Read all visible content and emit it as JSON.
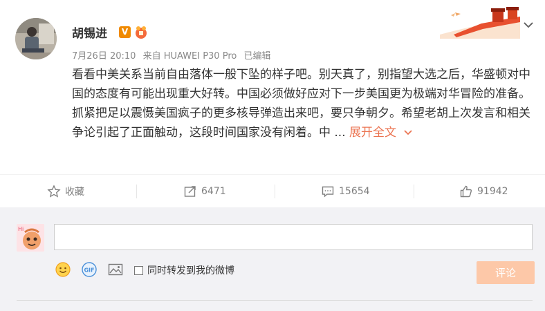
{
  "post": {
    "username": "胡锡进",
    "vip_badge": "V",
    "date": "7月26日 20:10",
    "source": "来自 HUAWEI P30 Pro",
    "edited": "已编辑",
    "paragraph1": "看看中美关系当前自由落体一般下坠的样子吧。别天真了，别指望大选之后，华盛顿对中国的态度有可能出现重大好转。中国必须做好应对下一步美国更为极端对华冒险的准备。",
    "paragraph2": "抓紧把足以震慑美国疯子的更多核导弹造出来吧，要只争朝夕。希望老胡上次发言和相关争论引起了正面触动，这段时间国家没有闲着。中 ...",
    "expand_label": "展开全文"
  },
  "actions": {
    "favorite_label": "收藏",
    "repost_count": "6471",
    "comment_count": "15654",
    "like_count": "91942"
  },
  "comment_box": {
    "input_value": "",
    "repost_checkbox_label": "同时转发到我的微博",
    "repost_checked": false,
    "submit_label": "评论",
    "gif_label": "GIF"
  },
  "colors": {
    "accent": "#eb7350",
    "submit_disabled": "#fdc8a8",
    "vip_orange": "#f08a00"
  }
}
